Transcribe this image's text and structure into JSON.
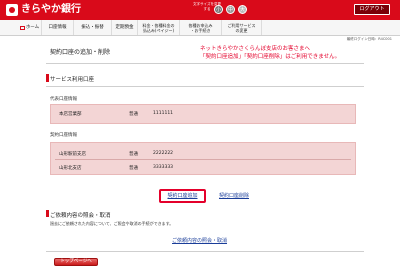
{
  "header": {
    "brand": "きらやか銀行",
    "font_size_label": "文字サイズを変更する",
    "font_sizes": [
      "小",
      "中",
      "大"
    ],
    "logout": "ログアウト"
  },
  "nav": {
    "home": "ホーム",
    "account": "口座情報",
    "transfer": "振込・振替",
    "deposit": "定期預金",
    "fees_line1": "料金・各種料金の",
    "fees_line2": "払込み(ペイジー)",
    "bill_line1": "各種お申込み",
    "bill_line2": "・お手続き",
    "service_line1": "ご利用サービス",
    "service_line2": "の変更"
  },
  "timestamp": "最終ログイン日時：R4C001",
  "page_title": "契約口座の追加・削除",
  "notice": {
    "line1": "ネットきらやかさくらんぼ支店のお客さまへ",
    "line2": "「契約口座追加」「契約口座削除」はご利用できません。"
  },
  "service_section": {
    "title": "サービス利用口座",
    "rep_label": "代表口座情報",
    "rep_account": {
      "branch": "本店営業部",
      "type": "普通",
      "number": "1111111"
    },
    "contract_label": "契約口座情報",
    "contract_accounts": [
      {
        "branch": "山形駅前支店",
        "type": "普通",
        "number": "2222222"
      },
      {
        "branch": "山形北支店",
        "type": "普通",
        "number": "3333333"
      }
    ]
  },
  "actions": {
    "add": "契約口座追加",
    "delete": "契約口座削除"
  },
  "inquiry": {
    "title": "ご依頼内容の照会・取消",
    "text": "過去にご依頼された内容について、ご照会や取消の手続ができます。",
    "link": "ご依頼内容の照会・取消"
  },
  "top_button": "トップページへ",
  "colors": {
    "brand_red": "#d90a1a",
    "notice_red": "#e4002b",
    "account_box": "#f3d5d5",
    "link_blue": "#1a3d99"
  }
}
